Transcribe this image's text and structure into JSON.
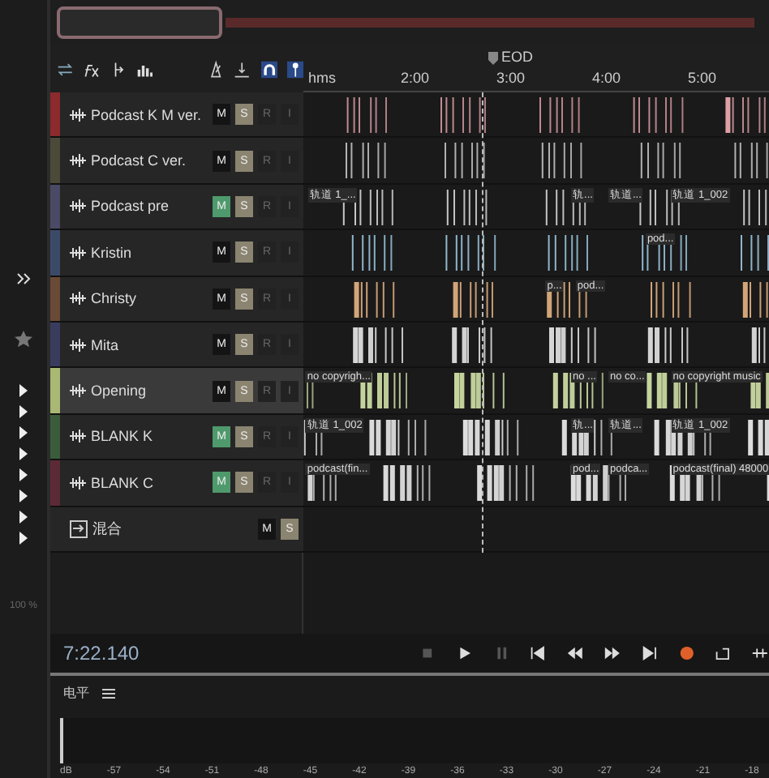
{
  "toolbar": {
    "ruler_unit": "hms",
    "ruler_marks": [
      "2:00",
      "3:00",
      "4:00",
      "5:00"
    ],
    "end_marker": "EOD"
  },
  "tracks": [
    {
      "name": "Podcast K M ver.",
      "color": "#8c2a2e",
      "muted": false,
      "selected": false,
      "buttons": [
        "M",
        "S",
        "R",
        "I"
      ]
    },
    {
      "name": "Podcast C ver.",
      "color": "#4b4a38",
      "muted": false,
      "selected": false,
      "buttons": [
        "M",
        "S",
        "R",
        "I"
      ]
    },
    {
      "name": "Podcast pre",
      "color": "#4a4a66",
      "muted": true,
      "selected": false,
      "buttons": [
        "M",
        "S",
        "R",
        "I"
      ],
      "clips": [
        "轨道 1_...",
        "轨...",
        "轨道...",
        "轨道 1_002"
      ]
    },
    {
      "name": "Kristin",
      "color": "#3c4a6a",
      "muted": false,
      "selected": false,
      "buttons": [
        "M",
        "S",
        "R",
        "I"
      ],
      "clips": [
        "pod..."
      ]
    },
    {
      "name": "Christy",
      "color": "#6a4a36",
      "muted": false,
      "selected": false,
      "buttons": [
        "M",
        "S",
        "R",
        "I"
      ],
      "clips": [
        "p...",
        "pod..."
      ]
    },
    {
      "name": "Mita",
      "color": "#3a3c5e",
      "muted": false,
      "selected": false,
      "buttons": [
        "M",
        "S",
        "R",
        "I"
      ]
    },
    {
      "name": "Opening",
      "color": "#a9b872",
      "muted": false,
      "selected": true,
      "buttons": [
        "M",
        "S",
        "R",
        "I"
      ],
      "clips": [
        "no copyrigh...",
        "no ...",
        "no co...",
        "no copyright music"
      ]
    },
    {
      "name": "BLANK K",
      "color": "#3a5c3a",
      "muted": true,
      "selected": false,
      "buttons": [
        "M",
        "S",
        "R",
        "I"
      ],
      "clips": [
        "轨道 1_002",
        "轨...",
        "轨道...",
        "轨道 1_002"
      ]
    },
    {
      "name": "BLANK C",
      "color": "#5c2a36",
      "muted": true,
      "selected": false,
      "buttons": [
        "M",
        "S",
        "R",
        "I"
      ],
      "clips": [
        "podcast(fin...",
        "pod...",
        "podca...",
        "podcast(final) 48000"
      ]
    }
  ],
  "master": {
    "name": "混合",
    "buttons": [
      "M",
      "S"
    ]
  },
  "sidebar": {
    "zoom": "100 %"
  },
  "transport": {
    "time": "7:22.140"
  },
  "level_meter": {
    "title": "电平",
    "scale": [
      "dB",
      "-57",
      "-54",
      "-51",
      "-48",
      "-45",
      "-42",
      "-39",
      "-36",
      "-33",
      "-30",
      "-27",
      "-24",
      "-21",
      "-18"
    ]
  }
}
